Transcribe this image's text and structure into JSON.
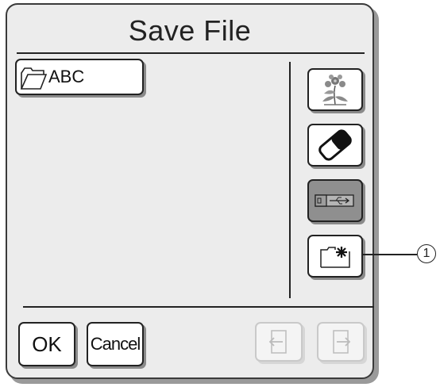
{
  "dialog": {
    "title": "Save File"
  },
  "files": [
    {
      "label": "ABC",
      "icon": "folder-icon"
    }
  ],
  "side_buttons": [
    {
      "name": "embroidery-pattern-button",
      "icon": "flower-pattern-icon",
      "state": "normal"
    },
    {
      "name": "machine-memory-button",
      "icon": "memory-chip-icon",
      "state": "normal"
    },
    {
      "name": "usb-media-button",
      "icon": "usb-icon",
      "state": "selected"
    },
    {
      "name": "new-folder-button",
      "icon": "new-folder-icon",
      "state": "normal"
    }
  ],
  "footer": {
    "ok_label": "OK",
    "cancel_label": "Cancel",
    "prev_page": {
      "icon": "page-left-arrow-icon",
      "enabled": false
    },
    "next_page": {
      "icon": "page-right-arrow-icon",
      "enabled": false
    }
  },
  "callout": {
    "label": "1"
  },
  "colors": {
    "panel_bg": "#ececec",
    "selected_button": "#8f8f8f",
    "disabled_border": "#c9c9c9"
  }
}
